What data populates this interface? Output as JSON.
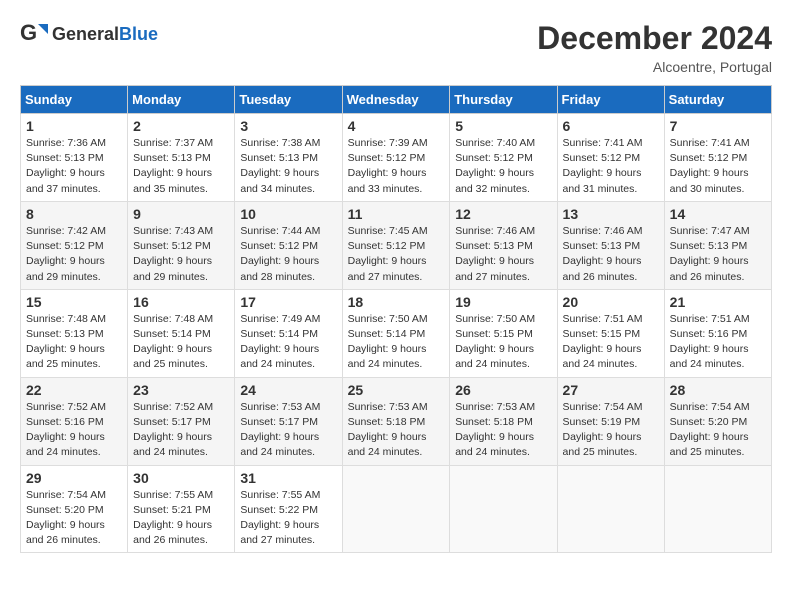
{
  "header": {
    "logo_general": "General",
    "logo_blue": "Blue",
    "month_title": "December 2024",
    "location": "Alcoentre, Portugal"
  },
  "days_of_week": [
    "Sunday",
    "Monday",
    "Tuesday",
    "Wednesday",
    "Thursday",
    "Friday",
    "Saturday"
  ],
  "weeks": [
    [
      {
        "day": "1",
        "info": "Sunrise: 7:36 AM\nSunset: 5:13 PM\nDaylight: 9 hours and 37 minutes."
      },
      {
        "day": "2",
        "info": "Sunrise: 7:37 AM\nSunset: 5:13 PM\nDaylight: 9 hours and 35 minutes."
      },
      {
        "day": "3",
        "info": "Sunrise: 7:38 AM\nSunset: 5:13 PM\nDaylight: 9 hours and 34 minutes."
      },
      {
        "day": "4",
        "info": "Sunrise: 7:39 AM\nSunset: 5:12 PM\nDaylight: 9 hours and 33 minutes."
      },
      {
        "day": "5",
        "info": "Sunrise: 7:40 AM\nSunset: 5:12 PM\nDaylight: 9 hours and 32 minutes."
      },
      {
        "day": "6",
        "info": "Sunrise: 7:41 AM\nSunset: 5:12 PM\nDaylight: 9 hours and 31 minutes."
      },
      {
        "day": "7",
        "info": "Sunrise: 7:41 AM\nSunset: 5:12 PM\nDaylight: 9 hours and 30 minutes."
      }
    ],
    [
      {
        "day": "8",
        "info": "Sunrise: 7:42 AM\nSunset: 5:12 PM\nDaylight: 9 hours and 29 minutes."
      },
      {
        "day": "9",
        "info": "Sunrise: 7:43 AM\nSunset: 5:12 PM\nDaylight: 9 hours and 29 minutes."
      },
      {
        "day": "10",
        "info": "Sunrise: 7:44 AM\nSunset: 5:12 PM\nDaylight: 9 hours and 28 minutes."
      },
      {
        "day": "11",
        "info": "Sunrise: 7:45 AM\nSunset: 5:12 PM\nDaylight: 9 hours and 27 minutes."
      },
      {
        "day": "12",
        "info": "Sunrise: 7:46 AM\nSunset: 5:13 PM\nDaylight: 9 hours and 27 minutes."
      },
      {
        "day": "13",
        "info": "Sunrise: 7:46 AM\nSunset: 5:13 PM\nDaylight: 9 hours and 26 minutes."
      },
      {
        "day": "14",
        "info": "Sunrise: 7:47 AM\nSunset: 5:13 PM\nDaylight: 9 hours and 26 minutes."
      }
    ],
    [
      {
        "day": "15",
        "info": "Sunrise: 7:48 AM\nSunset: 5:13 PM\nDaylight: 9 hours and 25 minutes."
      },
      {
        "day": "16",
        "info": "Sunrise: 7:48 AM\nSunset: 5:14 PM\nDaylight: 9 hours and 25 minutes."
      },
      {
        "day": "17",
        "info": "Sunrise: 7:49 AM\nSunset: 5:14 PM\nDaylight: 9 hours and 24 minutes."
      },
      {
        "day": "18",
        "info": "Sunrise: 7:50 AM\nSunset: 5:14 PM\nDaylight: 9 hours and 24 minutes."
      },
      {
        "day": "19",
        "info": "Sunrise: 7:50 AM\nSunset: 5:15 PM\nDaylight: 9 hours and 24 minutes."
      },
      {
        "day": "20",
        "info": "Sunrise: 7:51 AM\nSunset: 5:15 PM\nDaylight: 9 hours and 24 minutes."
      },
      {
        "day": "21",
        "info": "Sunrise: 7:51 AM\nSunset: 5:16 PM\nDaylight: 9 hours and 24 minutes."
      }
    ],
    [
      {
        "day": "22",
        "info": "Sunrise: 7:52 AM\nSunset: 5:16 PM\nDaylight: 9 hours and 24 minutes."
      },
      {
        "day": "23",
        "info": "Sunrise: 7:52 AM\nSunset: 5:17 PM\nDaylight: 9 hours and 24 minutes."
      },
      {
        "day": "24",
        "info": "Sunrise: 7:53 AM\nSunset: 5:17 PM\nDaylight: 9 hours and 24 minutes."
      },
      {
        "day": "25",
        "info": "Sunrise: 7:53 AM\nSunset: 5:18 PM\nDaylight: 9 hours and 24 minutes."
      },
      {
        "day": "26",
        "info": "Sunrise: 7:53 AM\nSunset: 5:18 PM\nDaylight: 9 hours and 24 minutes."
      },
      {
        "day": "27",
        "info": "Sunrise: 7:54 AM\nSunset: 5:19 PM\nDaylight: 9 hours and 25 minutes."
      },
      {
        "day": "28",
        "info": "Sunrise: 7:54 AM\nSunset: 5:20 PM\nDaylight: 9 hours and 25 minutes."
      }
    ],
    [
      {
        "day": "29",
        "info": "Sunrise: 7:54 AM\nSunset: 5:20 PM\nDaylight: 9 hours and 26 minutes."
      },
      {
        "day": "30",
        "info": "Sunrise: 7:55 AM\nSunset: 5:21 PM\nDaylight: 9 hours and 26 minutes."
      },
      {
        "day": "31",
        "info": "Sunrise: 7:55 AM\nSunset: 5:22 PM\nDaylight: 9 hours and 27 minutes."
      },
      {
        "day": "",
        "info": ""
      },
      {
        "day": "",
        "info": ""
      },
      {
        "day": "",
        "info": ""
      },
      {
        "day": "",
        "info": ""
      }
    ]
  ]
}
